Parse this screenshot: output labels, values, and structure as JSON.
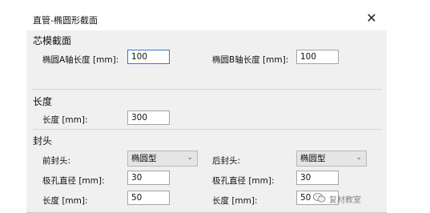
{
  "window": {
    "title": "直管-椭圆形截面",
    "close_glyph": "✕"
  },
  "core_section": {
    "heading": "芯模截面",
    "a_axis_label": "椭圆A轴长度 [mm]:",
    "a_axis_value": "100",
    "b_axis_label": "椭圆B轴长度 [mm]:",
    "b_axis_value": "100"
  },
  "length_section": {
    "heading": "长度",
    "length_label": "长度 [mm]:",
    "length_value": "300"
  },
  "head_section": {
    "heading": "封头",
    "front": {
      "label": "前封头:",
      "type_value": "椭圆型",
      "hole_label": "极孔直径 [mm]:",
      "hole_value": "30",
      "length_label": "长度 [mm]:",
      "length_value": "50"
    },
    "rear": {
      "label": "后封头:",
      "type_value": "椭圆型",
      "hole_label": "极孔直径 [mm]:",
      "hole_value": "30",
      "length_label": "长度 [mm]:",
      "length_value": "50"
    }
  },
  "watermark": {
    "text": "复材教室",
    "icon": "wechat-icon"
  }
}
